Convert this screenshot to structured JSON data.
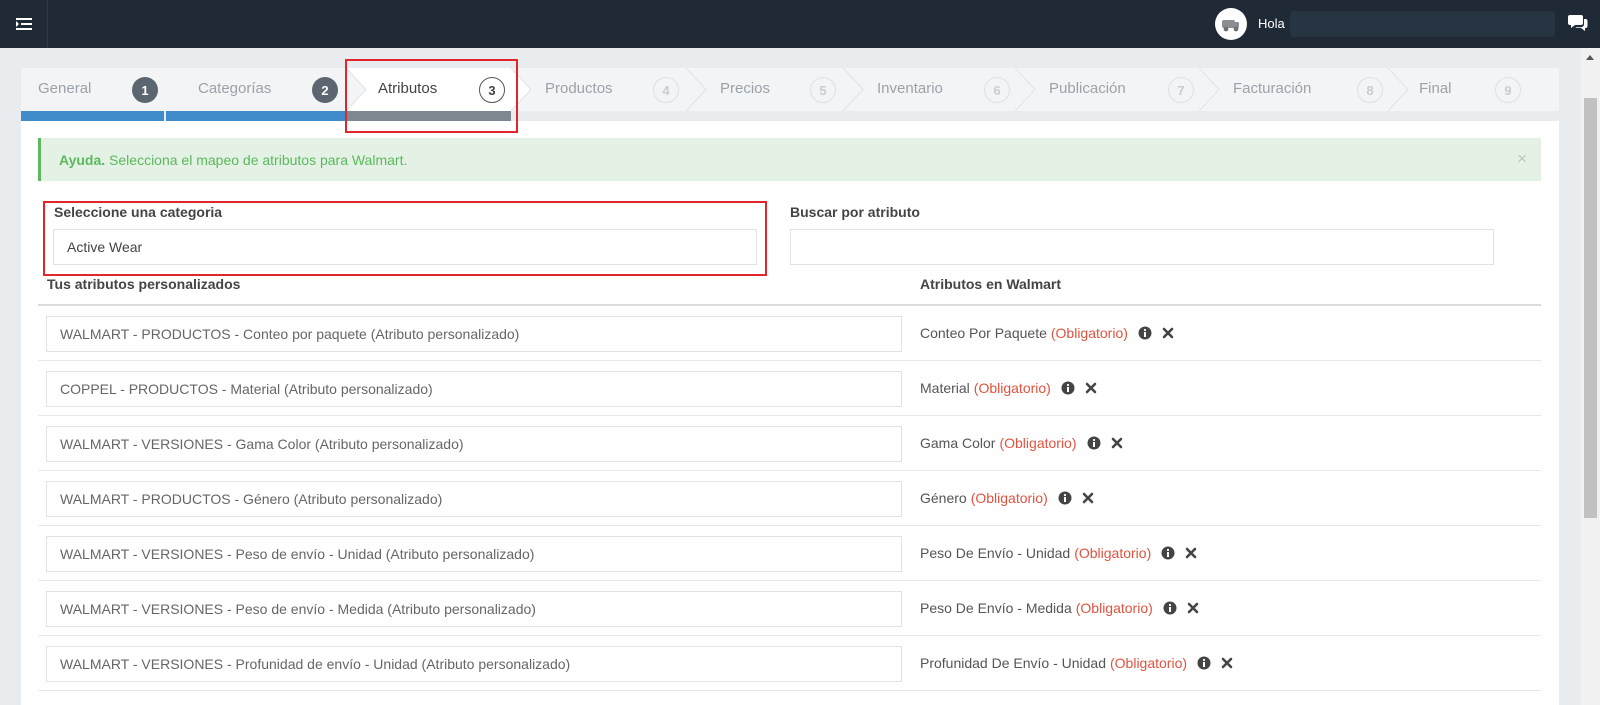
{
  "header": {
    "greeting": "Hola",
    "icons": [
      "menu-icon",
      "avatar-icon",
      "chat-icon"
    ]
  },
  "wizard": {
    "steps": [
      {
        "label": "General",
        "num": "1",
        "state": "done"
      },
      {
        "label": "Categorías",
        "num": "2",
        "state": "done"
      },
      {
        "label": "Atributos",
        "num": "3",
        "state": "active"
      },
      {
        "label": "Productos",
        "num": "4",
        "state": "todo"
      },
      {
        "label": "Precios",
        "num": "5",
        "state": "todo"
      },
      {
        "label": "Inventario",
        "num": "6",
        "state": "todo"
      },
      {
        "label": "Publicación",
        "num": "7",
        "state": "todo"
      },
      {
        "label": "Facturación",
        "num": "8",
        "state": "todo"
      },
      {
        "label": "Final",
        "num": "9",
        "state": "todo"
      }
    ]
  },
  "alert": {
    "title": "Ayuda.",
    "message": "Selecciona el mapeo de atributos para Walmart.",
    "close": "×"
  },
  "form": {
    "category_label": "Seleccione una categoria",
    "category_value": "Active Wear",
    "search_label": "Buscar por atributo",
    "search_value": ""
  },
  "table": {
    "col_custom": "Tus atributos personalizados",
    "col_walmart": "Atributos en Walmart",
    "required_text": "(Obligatorio)",
    "rows": [
      {
        "custom": "WALMART - PRODUCTOS - Conteo por paquete (Atributo personalizado)",
        "walmart": "Conteo Por Paquete"
      },
      {
        "custom": "COPPEL - PRODUCTOS - Material (Atributo personalizado)",
        "walmart": "Material"
      },
      {
        "custom": "WALMART - VERSIONES - Gama Color (Atributo personalizado)",
        "walmart": "Gama Color"
      },
      {
        "custom": "WALMART - PRODUCTOS - Género (Atributo personalizado)",
        "walmart": "Género"
      },
      {
        "custom": "WALMART - VERSIONES - Peso de envío - Unidad (Atributo personalizado)",
        "walmart": "Peso De Envío - Unidad"
      },
      {
        "custom": "WALMART - VERSIONES - Peso de envío - Medida (Atributo personalizado)",
        "walmart": "Peso De Envío - Medida"
      },
      {
        "custom": "WALMART - VERSIONES - Profunidad de envío - Unidad (Atributo personalizado)",
        "walmart": "Profunidad De Envío - Unidad"
      }
    ]
  },
  "colors": {
    "topbar": "#1f2a36",
    "progress_done": "#428bca",
    "progress_active": "#7d8891",
    "alert_green": "#5cb85c",
    "required_red": "#e0533f",
    "highlight_red": "#e0262b"
  }
}
